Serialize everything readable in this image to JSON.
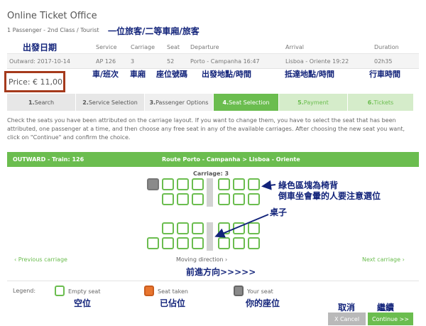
{
  "header": {
    "title": "Online Ticket Office",
    "subtitle": "1 Passenger - 2nd Class / Tourist"
  },
  "journey": {
    "columns": [
      "Service",
      "Carriage",
      "Seat",
      "Departure",
      "Arrival",
      "Duration"
    ],
    "row": {
      "outward": "Outward: 2017-10-14",
      "service": "AP 126",
      "carriage": "3",
      "seat": "52",
      "departure": "Porto - Campanha 16:47",
      "arrival": "Lisboa - Oriente 19:22",
      "duration": "02h35"
    }
  },
  "price": "Price: € 11,00",
  "steps": [
    {
      "num": "1.",
      "label": "Search",
      "state": "done"
    },
    {
      "num": "2.",
      "label": "Service Selection",
      "state": "done"
    },
    {
      "num": "3.",
      "label": "Passenger Options",
      "state": "done"
    },
    {
      "num": "4.",
      "label": "Seat Selection",
      "state": "active"
    },
    {
      "num": "5.",
      "label": "Payment",
      "state": "todo"
    },
    {
      "num": "6.",
      "label": "Tickets",
      "state": "todo"
    }
  ],
  "instructions": "Check the seats you have been attributed on the carriage layout. If you want to change them, you have to select the seat that has been attributed, one passenger at a time, and then choose any free seat in any of the available carriages. After choosing the new seat you want, click on \"Continue\" and confirm the choice.",
  "train": {
    "name": "OUTWARD - Train: 126",
    "route": "Route Porto - Campanha > Lisboa - Oriente",
    "carriage": "Carriage: 3"
  },
  "nav": {
    "prev": "‹ Previous carriage",
    "moving": "Moving direction ›",
    "next": "Next carriage ›"
  },
  "legend": {
    "label": "Legend:",
    "empty": "Empty seat",
    "taken": "Seat taken",
    "yours": "Your seat"
  },
  "buttons": {
    "cancel": "X Cancel",
    "continue": "Continue >>"
  },
  "annotations": {
    "subtitle": "一位旅客/二等車廂/旅客",
    "date": "出發日期",
    "service": "車/班次",
    "carriage": "車廂",
    "seat": "座位號碼",
    "departure": "出發地點/時間",
    "arrival": "抵達地點/時間",
    "duration": "行車時間",
    "green_area": "綠色區塊為椅背",
    "reverse": "倒車坐會暈的人要注意選位",
    "table": "桌子",
    "direction": "前進方向>>>>>",
    "empty": "空位",
    "taken": "已佔位",
    "yours": "你的座位",
    "cancel": "取消",
    "continue": "繼續"
  },
  "colors": {
    "green": "#6bbd4f",
    "light_green": "#cfe9c4",
    "taken": "#e8752e",
    "mine": "#8a8a8a",
    "price_border": "#a53a1c",
    "annotation": "#12237a",
    "cancel_button": "#b9b9b9"
  }
}
